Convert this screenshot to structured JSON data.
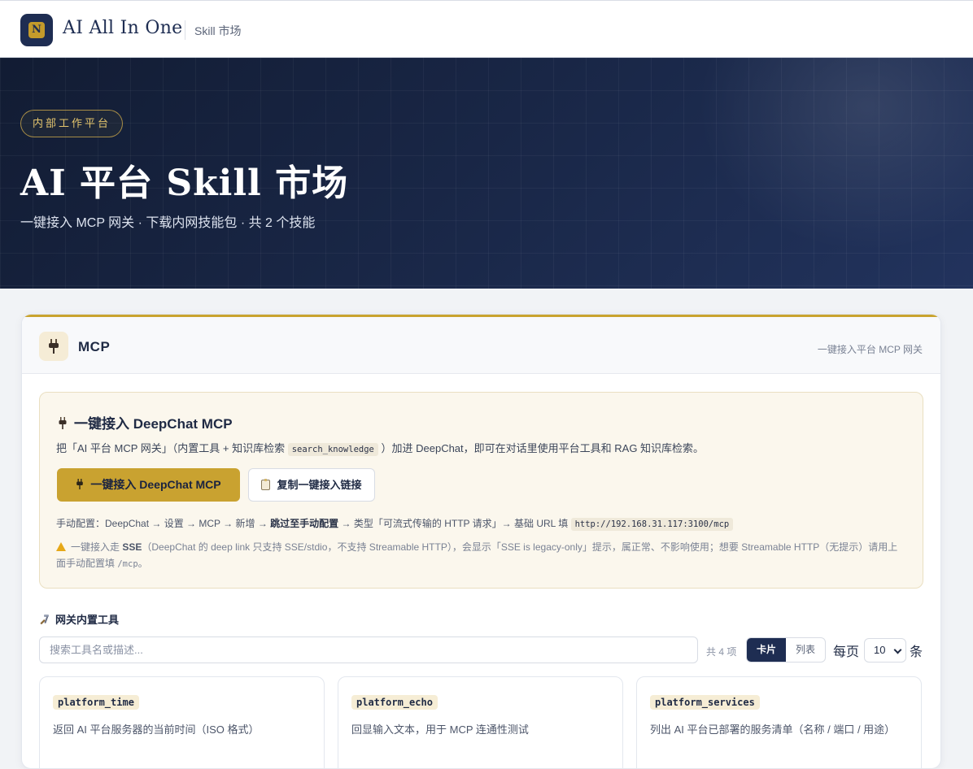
{
  "header": {
    "logo_letter": "N",
    "brand": "AI All In One",
    "subtitle": "Skill 市场"
  },
  "hero": {
    "badge": "内部工作平台",
    "title": "AI 平台 Skill 市场",
    "subtitle": "一键接入 MCP 网关 · 下载内网技能包 · 共 2 个技能"
  },
  "mcp_panel": {
    "title": "MCP",
    "hint": "一键接入平台 MCP 网关",
    "callout": {
      "title": "一键接入 DeepChat MCP",
      "desc_before": "把「AI 平台 MCP 网关」（内置工具 + 知识库检索",
      "desc_code": "search_knowledge",
      "desc_after": "）加进 DeepChat，即可在对话里使用平台工具和 RAG 知识库检索。",
      "primary_button": "一键接入 DeepChat MCP",
      "secondary_button": "复制一键接入链接",
      "manual_prefix": "手动配置：DeepChat → 设置 → MCP → 新增 →",
      "manual_bold": "跳过至手动配置",
      "manual_mid": "→ 类型「可流式传输的 HTTP 请求」→ 基础 URL 填",
      "manual_url": "http://192.168.31.117:3100/mcp",
      "warn_prefix": "一键接入走",
      "warn_bold": "SSE",
      "warn_text": "（DeepChat 的 deep link 只支持 SSE/stdio，不支持 Streamable HTTP），会显示「SSE is legacy-only」提示，属正常、不影响使用；想要 Streamable HTTP（无提示）请用上面手动配置填",
      "warn_code": "/mcp",
      "warn_end": "。"
    },
    "tools": {
      "title": "网关内置工具",
      "search_placeholder": "搜索工具名或描述...",
      "count": "共 4 项",
      "view_card": "卡片",
      "view_list": "列表",
      "per_page_label": "每页",
      "per_page_value": "10",
      "per_page_unit": "条",
      "cards": [
        {
          "name": "platform_time",
          "desc": "返回 AI 平台服务器的当前时间（ISO 格式）"
        },
        {
          "name": "platform_echo",
          "desc": "回显输入文本，用于 MCP 连通性测试"
        },
        {
          "name": "platform_services",
          "desc": "列出 AI 平台已部署的服务清单（名称 / 端口 / 用途）"
        }
      ]
    }
  },
  "colors": {
    "navy": "#1e2d52",
    "gold": "#c9a230",
    "hero_bg": "#17223d"
  }
}
